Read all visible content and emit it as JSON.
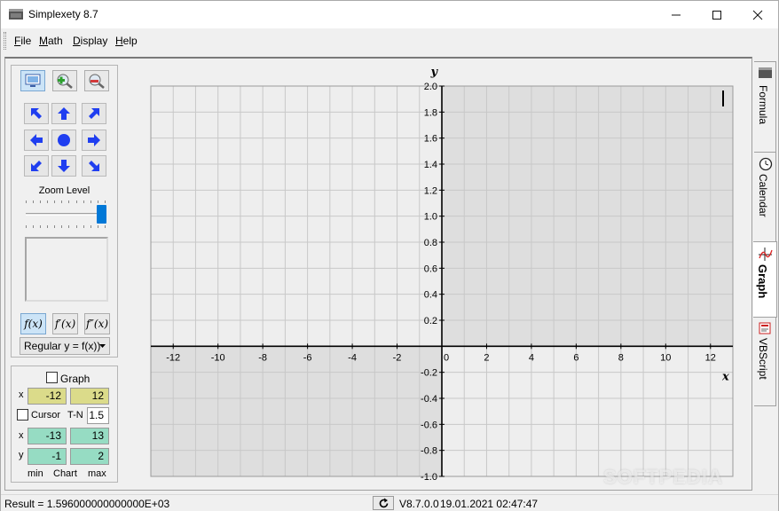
{
  "window": {
    "title": "Simplexety 8.7"
  },
  "menu": [
    {
      "underline": "F",
      "rest": "ile"
    },
    {
      "underline": "M",
      "rest": "ath"
    },
    {
      "underline": "D",
      "rest": "isplay"
    },
    {
      "underline": "H",
      "rest": "elp"
    }
  ],
  "controls": {
    "zoom_label": "Zoom Level",
    "zoom_level": 1.0,
    "mode_dropdown": "Regular y = f(x))",
    "f_buttons": [
      "f(x)",
      "f′(x)",
      "f″(x)"
    ],
    "icons": [
      "screen-icon",
      "zoom-in-icon",
      "zoom-out-icon",
      "arrow-up-left-icon",
      "arrow-up-icon",
      "arrow-up-right-icon",
      "arrow-left-icon",
      "center-dot-icon",
      "arrow-right-icon",
      "arrow-down-left-icon",
      "arrow-down-icon",
      "arrow-down-right-icon"
    ]
  },
  "range": {
    "graph_label": "Graph",
    "graph_x_min": "-12",
    "graph_x_max": "12",
    "cursor_label": "Cursor",
    "tn_label": "T-N",
    "tn_value": "1.5",
    "chart_x_min": "-13",
    "chart_x_max": "13",
    "chart_y_min": "-1",
    "chart_y_max": "2",
    "x_label": "x",
    "y_label": "y",
    "min_label": "min",
    "chart_label": "Chart",
    "max_label": "max"
  },
  "graph": {
    "x_axis_label": "x",
    "y_axis_label": "y",
    "xlim": [
      -13,
      13
    ],
    "ylim": [
      -1,
      2
    ],
    "x_ticks": [
      "-12",
      "-10",
      "-8",
      "-6",
      "-4",
      "-2",
      "0",
      "2",
      "4",
      "6",
      "8",
      "10",
      "12"
    ],
    "y_ticks": [
      "2.0",
      "1.8",
      "1.6",
      "1.4",
      "1.2",
      "1.0",
      "0.8",
      "0.6",
      "0.4",
      "0.2",
      "-0.2",
      "-0.4",
      "-0.6",
      "-0.8",
      "-1.0"
    ],
    "colors": {
      "plot_bg": "#eeeeee",
      "shaded": "#dedede",
      "grid": "#c8c8c8",
      "axis": "#000000"
    }
  },
  "tabs": [
    "Formula",
    "Calendar",
    "Graph",
    "VBScript"
  ],
  "status": {
    "result": "Result = 1.596000000000000E+03",
    "version": "V8.7.0.0",
    "datetime": "19.01.2021 02:47:47"
  },
  "watermark": "SOFTPEDIA"
}
